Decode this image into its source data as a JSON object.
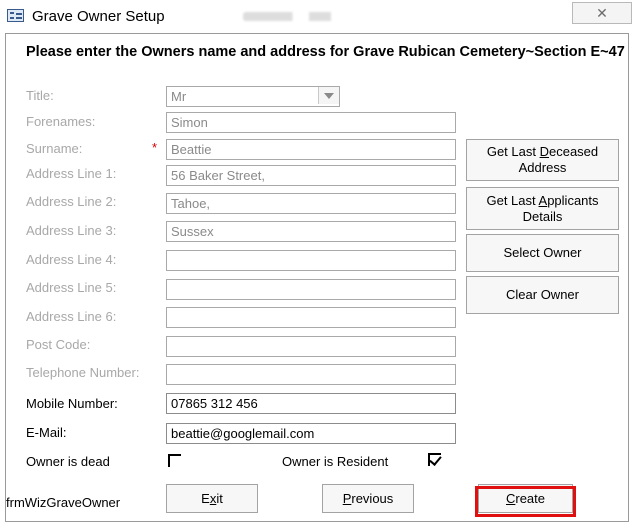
{
  "window": {
    "title": "Grave Owner Setup",
    "close_label": "✕"
  },
  "heading": "Please enter the Owners name and address for Grave Rubican Cemetery~Section E~47",
  "fields": {
    "title": {
      "label": "Title:",
      "value": "Mr"
    },
    "forenames": {
      "label": "Forenames:",
      "value": "Simon"
    },
    "surname": {
      "label": "Surname:",
      "value": "Beattie",
      "required_marker": "*"
    },
    "address1": {
      "label": "Address Line 1:",
      "value": "56 Baker Street,"
    },
    "address2": {
      "label": "Address Line 2:",
      "value": "Tahoe,"
    },
    "address3": {
      "label": "Address Line 3:",
      "value": "Sussex"
    },
    "address4": {
      "label": "Address Line 4:",
      "value": ""
    },
    "address5": {
      "label": "Address Line 5:",
      "value": ""
    },
    "address6": {
      "label": "Address Line 6:",
      "value": ""
    },
    "postcode": {
      "label": "Post Code:",
      "value": ""
    },
    "telephone": {
      "label": "Telephone Number:",
      "value": ""
    },
    "mobile": {
      "label": "Mobile Number:",
      "value": "07865 312 456"
    },
    "email": {
      "label": "E-Mail:",
      "value": "beattie@googlemail.com"
    }
  },
  "checkboxes": {
    "owner_dead": {
      "label": "Owner is dead",
      "checked": false
    },
    "owner_resident": {
      "label": "Owner is Resident",
      "checked": true
    }
  },
  "side_buttons": {
    "last_deceased": {
      "pre": "Get Last ",
      "accel": "D",
      "post": "eceased",
      "line2": "Address"
    },
    "last_applicants": {
      "pre": "Get Last ",
      "accel": "A",
      "post": "pplicants",
      "line2": "Details"
    },
    "select_owner": {
      "label": "Select Owner"
    },
    "clear_owner": {
      "label": "Clear Owner"
    }
  },
  "footer": {
    "form_name": "frmWizGraveOwner",
    "exit": {
      "pre": "E",
      "accel": "x",
      "post": "it"
    },
    "previous": {
      "pre": "",
      "accel": "P",
      "post": "revious"
    },
    "create": {
      "pre": "",
      "accel": "C",
      "post": "reate"
    }
  },
  "colors": {
    "highlight": "#e01010",
    "disabled_text": "#a8a8a8"
  }
}
